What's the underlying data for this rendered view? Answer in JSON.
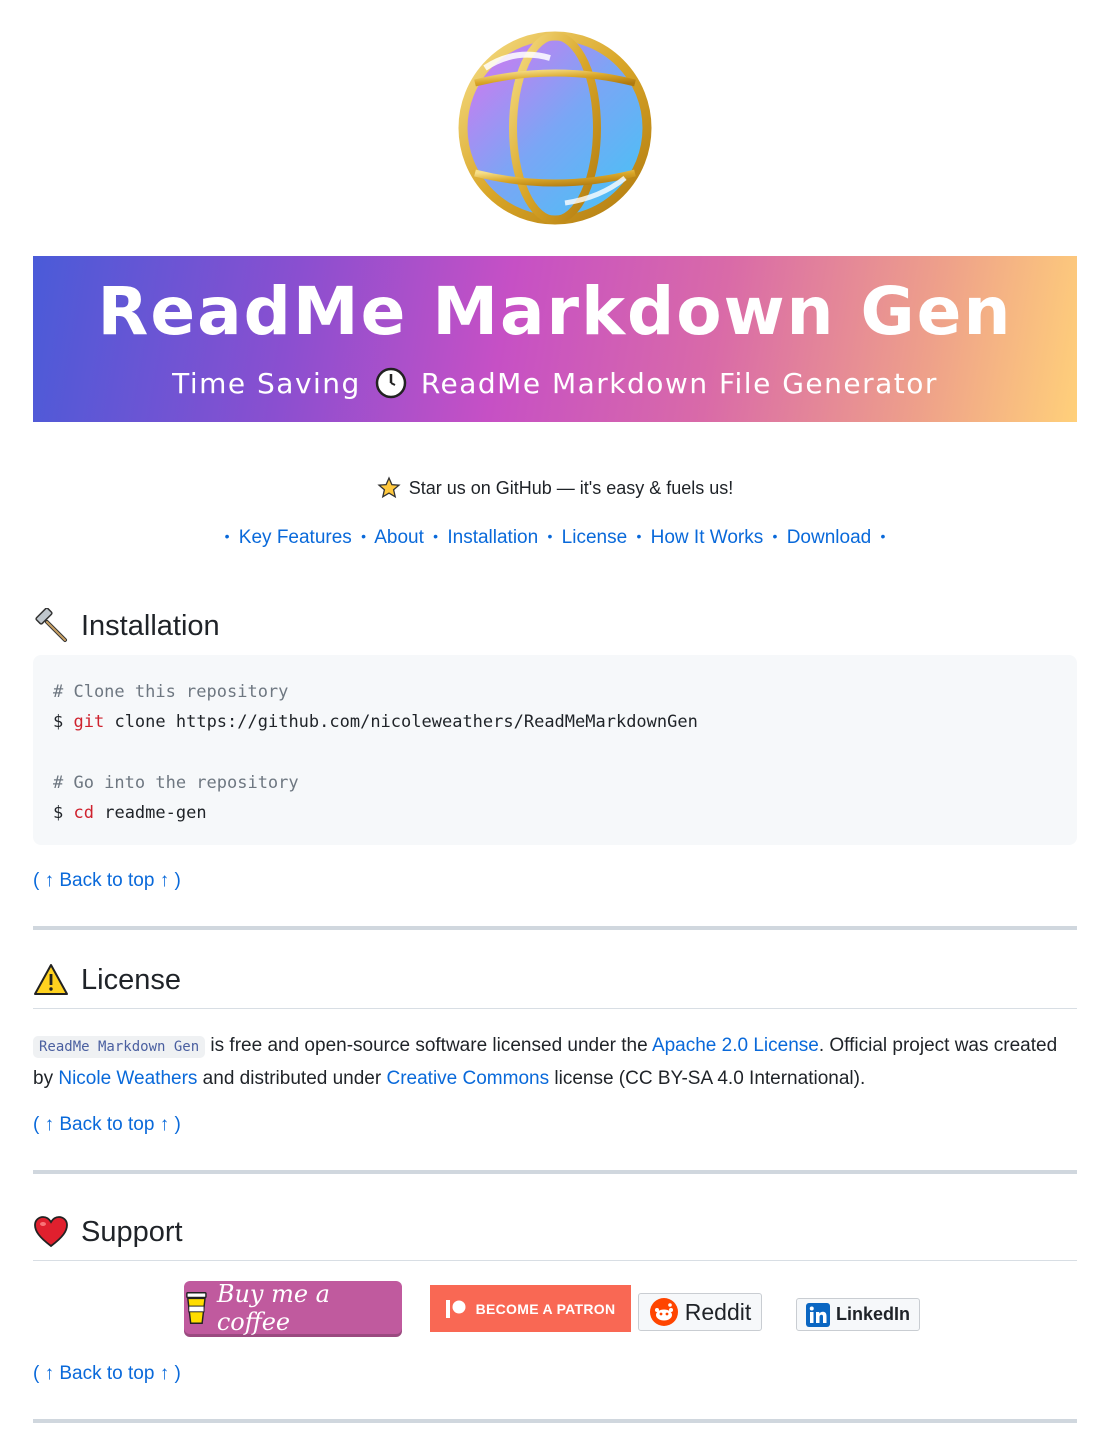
{
  "header": {
    "logo_icon": "globe-icon",
    "title": "ReadMe Markdown Gen",
    "subtitle_part1": "Time Saving",
    "subtitle_icon": "clock-icon",
    "subtitle_part2": "ReadMe Markdown File Generator"
  },
  "star_line": "Star us on GitHub — it's easy & fuels us!",
  "nav": {
    "items": [
      "Key Features",
      "About",
      "Installation",
      "License",
      "How It Works",
      "Download"
    ],
    "separator": "•"
  },
  "installation": {
    "heading": "Installation",
    "icon": "hammer-icon",
    "code": {
      "comment1": "# Clone this repository",
      "prompt1": "$",
      "cmd1": "git",
      "args1": " clone https://github.com/nicoleweathers/ReadMeMarkdownGen",
      "comment2": "# Go into the repository",
      "prompt2": "$",
      "cmd2": "cd",
      "args2": " readme-gen"
    },
    "back_to_top": "( ↑ Back to top ↑ )"
  },
  "license": {
    "heading": "License",
    "icon": "warning-icon",
    "code_name": "ReadMe Markdown Gen",
    "text1": " is free and open-source software licensed under the ",
    "link_apache": "Apache 2.0 License",
    "text2": ". Official project was created by ",
    "link_author": "Nicole Weathers",
    "text3": " and distributed under ",
    "link_cc": "Creative Commons",
    "text4": " license (CC BY-SA 4.0 International).",
    "back_to_top": "( ↑ Back to top ↑ )"
  },
  "support": {
    "heading": "Support",
    "icon": "heart-icon",
    "buttons": {
      "coffee": "Buy me a coffee",
      "patron": "BECOME A PATRON",
      "reddit": "Reddit",
      "linkedin": "LinkedIn"
    },
    "back_to_top": "( ↑ Back to top ↑ )"
  },
  "colors": {
    "link": "#0969da",
    "banner_start": "#4a5bd8",
    "banner_mid": "#c650c5",
    "banner_end": "#ffd07a",
    "patreon": "#f96854",
    "coffee": "#c05a9e"
  }
}
